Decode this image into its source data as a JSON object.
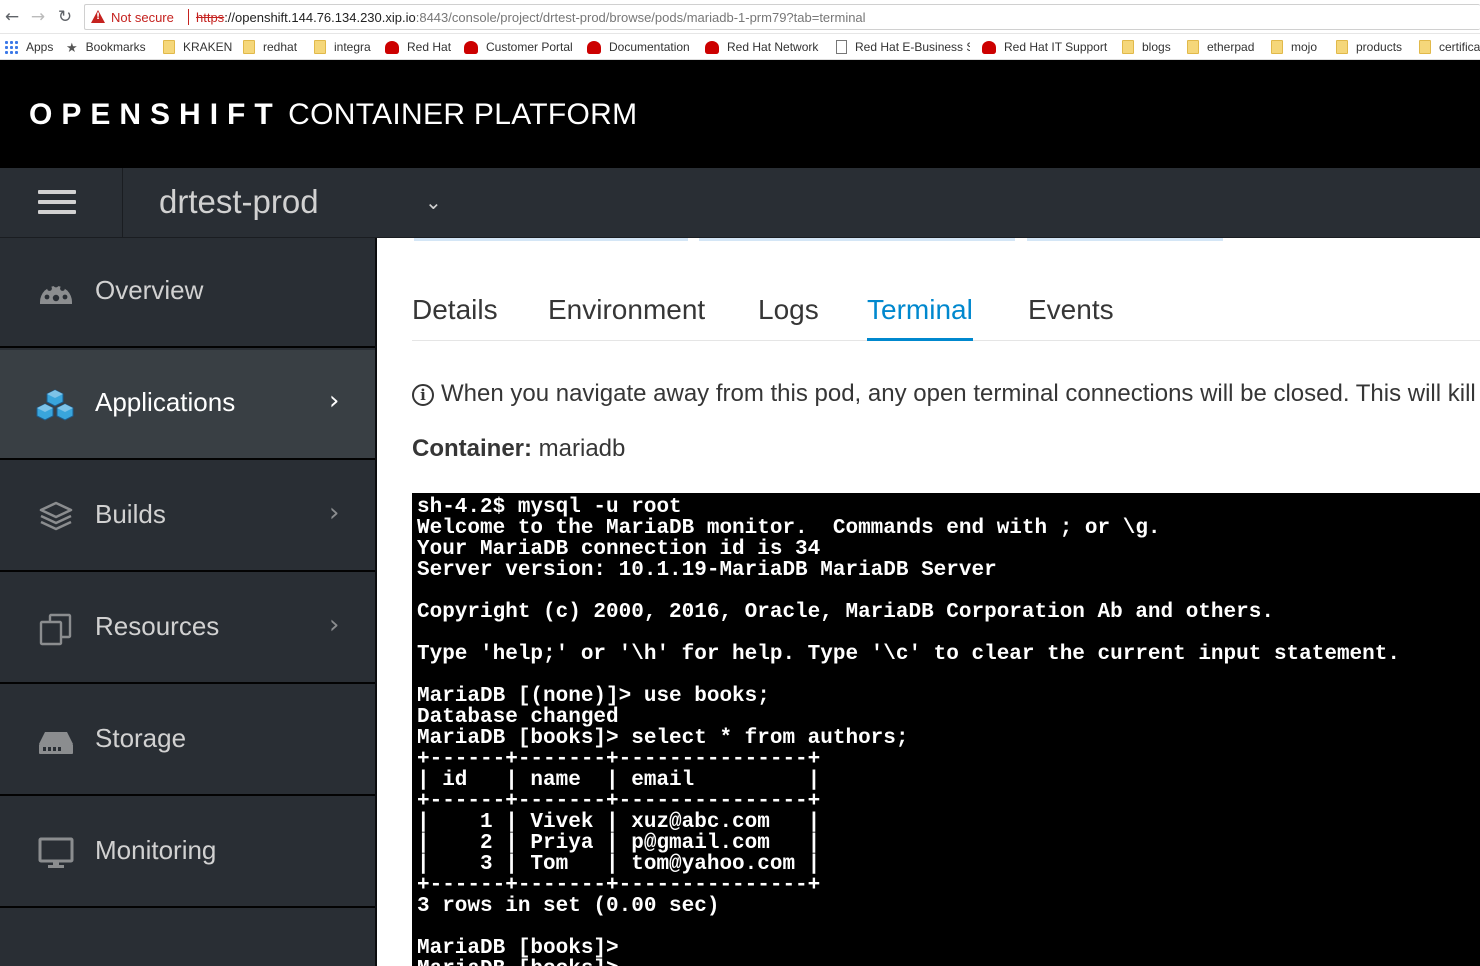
{
  "browser": {
    "security_label": "Not secure",
    "url_scheme": "https",
    "url_host": "://openshift.144.76.134.230.xip.io",
    "url_rest": ":8443/console/project/drtest-prod/browse/pods/mariadb-1-prm79?tab=terminal",
    "bookmarks": [
      {
        "label": "Apps",
        "icon": "apps-grid-icon"
      },
      {
        "label": "Bookmarks",
        "icon": "star-icon"
      },
      {
        "label": "KRAKEN",
        "icon": "folder-icon"
      },
      {
        "label": "redhat",
        "icon": "folder-icon"
      },
      {
        "label": "integra",
        "icon": "folder-icon"
      },
      {
        "label": "Red Hat",
        "icon": "redhat-icon"
      },
      {
        "label": "Customer Portal",
        "icon": "redhat-icon"
      },
      {
        "label": "Documentation",
        "icon": "redhat-icon"
      },
      {
        "label": "Red Hat Network",
        "icon": "redhat-icon"
      },
      {
        "label": "Red Hat E-Business S",
        "icon": "page-icon"
      },
      {
        "label": "Red Hat IT Support",
        "icon": "redhat-icon"
      },
      {
        "label": "blogs",
        "icon": "folder-icon"
      },
      {
        "label": "etherpad",
        "icon": "folder-icon"
      },
      {
        "label": "mojo",
        "icon": "folder-icon"
      },
      {
        "label": "products",
        "icon": "folder-icon"
      },
      {
        "label": "certifica",
        "icon": "folder-icon"
      }
    ]
  },
  "masthead": {
    "brand_main": "OPENSHIFT",
    "brand_sub": "CONTAINER PLATFORM"
  },
  "project": {
    "name": "drtest-prod"
  },
  "sidebar": {
    "items": [
      {
        "label": "Overview",
        "icon": "dashboard-icon",
        "active": false
      },
      {
        "label": "Applications",
        "icon": "cubes-icon",
        "active": true
      },
      {
        "label": "Builds",
        "icon": "layers-icon",
        "active": false
      },
      {
        "label": "Resources",
        "icon": "copy-icon",
        "active": false
      },
      {
        "label": "Storage",
        "icon": "hard-drive-icon",
        "active": false
      },
      {
        "label": "Monitoring",
        "icon": "monitor-icon",
        "active": false
      }
    ]
  },
  "tabs": [
    {
      "label": "Details",
      "active": false
    },
    {
      "label": "Environment",
      "active": false
    },
    {
      "label": "Logs",
      "active": false
    },
    {
      "label": "Terminal",
      "active": true
    },
    {
      "label": "Events",
      "active": false
    }
  ],
  "notice": {
    "text": "When you navigate away from this pod, any open terminal connections will be closed. This will kill a"
  },
  "container": {
    "label": "Container:",
    "value": "mariadb"
  },
  "terminal": {
    "lines": [
      "sh-4.2$ mysql -u root",
      "Welcome to the MariaDB monitor.  Commands end with ; or \\g.",
      "Your MariaDB connection id is 34",
      "Server version: 10.1.19-MariaDB MariaDB Server",
      "",
      "Copyright (c) 2000, 2016, Oracle, MariaDB Corporation Ab and others.",
      "",
      "Type 'help;' or '\\h' for help. Type '\\c' to clear the current input statement.",
      "",
      "MariaDB [(none)]> use books;",
      "Database changed",
      "MariaDB [books]> select * from authors;",
      "+------+-------+---------------+",
      "| id   | name  | email         |",
      "+------+-------+---------------+",
      "|    1 | Vivek | xuz@abc.com   |",
      "|    2 | Priya | p@gmail.com   |",
      "|    3 | Tom   | tom@yahoo.com |",
      "+------+-------+---------------+",
      "3 rows in set (0.00 sec)",
      "",
      "MariaDB [books]>",
      "MariaDB [books]>"
    ]
  },
  "colors": {
    "masthead_bg": "#000000",
    "sidebar_bg": "#292e34",
    "sidebar_active_bg": "#393f44",
    "tab_active": "#0088ce",
    "terminal_bg": "#000000",
    "terminal_fg": "#ffffff",
    "insecure_red": "#c5221f"
  }
}
